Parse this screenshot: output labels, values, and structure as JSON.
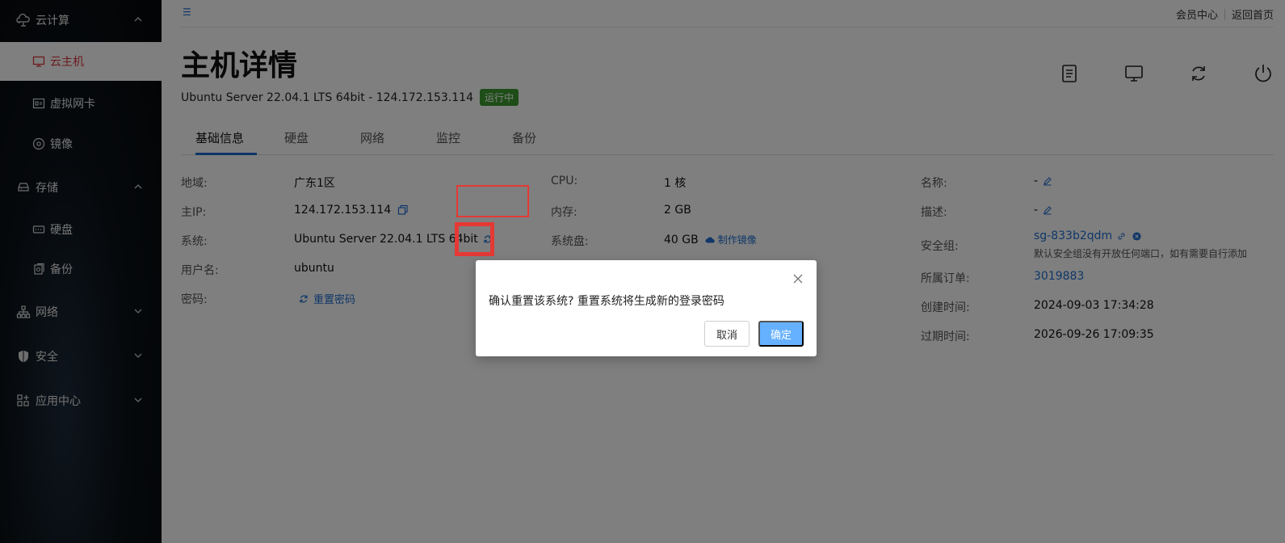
{
  "sidebar": {
    "groups": [
      {
        "label": "云计算",
        "icon": "cloud-icon"
      },
      {
        "label": "存储",
        "icon": "storage-icon"
      },
      {
        "label": "网络",
        "icon": "network-icon"
      },
      {
        "label": "安全",
        "icon": "shield-icon"
      },
      {
        "label": "应用中心",
        "icon": "apps-icon"
      }
    ],
    "items": [
      {
        "label": "云主机",
        "icon": "monitor-icon"
      },
      {
        "label": "虚拟网卡",
        "icon": "nic-icon"
      },
      {
        "label": "镜像",
        "icon": "disc-icon"
      },
      {
        "label": "硬盘",
        "icon": "disk-icon"
      },
      {
        "label": "备份",
        "icon": "backup-icon"
      }
    ]
  },
  "topnav": {
    "member_center": "会员中心",
    "back_home": "返回首页"
  },
  "page": {
    "title": "主机详情",
    "subtitle": "Ubuntu Server 22.04.1 LTS 64bit - 124.172.153.114",
    "status": "运行中"
  },
  "tabs": [
    "基础信息",
    "硬盘",
    "网络",
    "监控",
    "备份"
  ],
  "info_left": {
    "region_label": "地域:",
    "region": "广东1区",
    "ip_label": "主IP:",
    "ip": "124.172.153.114",
    "os_label": "系统:",
    "os": "Ubuntu Server 22.04.1 LTS 64bit",
    "user_label": "用户名:",
    "user": "ubuntu",
    "pwd_label": "密码:",
    "reset_pwd": "重置密码"
  },
  "info_mid": {
    "cpu_label": "CPU:",
    "cpu": "1 核",
    "mem_label": "内存:",
    "mem": "2 GB",
    "disk_label": "系统盘:",
    "disk": "40 GB",
    "make_image": "制作镜像"
  },
  "info_right": {
    "name_label": "名称:",
    "name": "-",
    "desc_label": "描述:",
    "desc": "-",
    "sg_label": "安全组:",
    "sg": "sg-833b2qdm",
    "sg_note": "默认安全组没有开放任何端口，如有需要自行添加",
    "order_label": "所属订单:",
    "order": "3019883",
    "created_label": "创建时间:",
    "created": "2024-09-03 17:34:28",
    "expire_label": "过期时间:",
    "expire": "2026-09-26 17:09:35"
  },
  "dialog": {
    "message": "确认重置该系统? 重置系统将生成新的登录密码",
    "cancel": "取消",
    "ok": "确定"
  },
  "colors": {
    "accent": "#1f6fd1",
    "status": "#3c9a2f",
    "highlight": "#e53935",
    "active_nav": "#d9363e"
  }
}
